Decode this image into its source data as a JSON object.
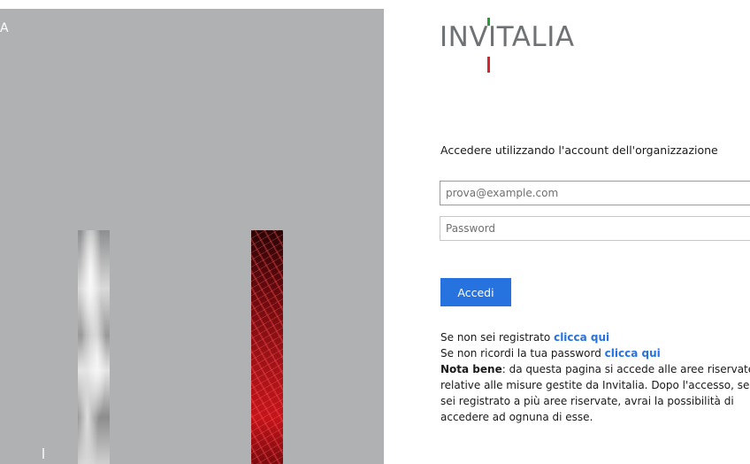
{
  "left_panel": {
    "corner_text": "A"
  },
  "logo": {
    "text": "INVITALIA",
    "colors": {
      "text": "#6f7275",
      "green": "#2a9a3a",
      "red": "#d8232a"
    }
  },
  "login": {
    "prompt": "Accedere utilizzando l'account dell'organizzazione",
    "email_placeholder": "prova@example.com",
    "password_placeholder": "Password",
    "submit_label": "Accedi"
  },
  "info": {
    "register_text": "Se non sei registrato ",
    "register_link": "clicca qui",
    "forgot_text": "Se non ricordi la tua password ",
    "forgot_link": "clicca qui",
    "note_label": "Nota bene",
    "note_text": ": da questa pagina si accede alle aree riservate relative alle misure gestite da Invitalia. Dopo l'accesso, se sei registrato a più aree riservate, avrai la possibilità di accedere ad ognuna di esse."
  },
  "colors": {
    "accent": "#2672de",
    "panel_gray": "#b0b1b3"
  }
}
